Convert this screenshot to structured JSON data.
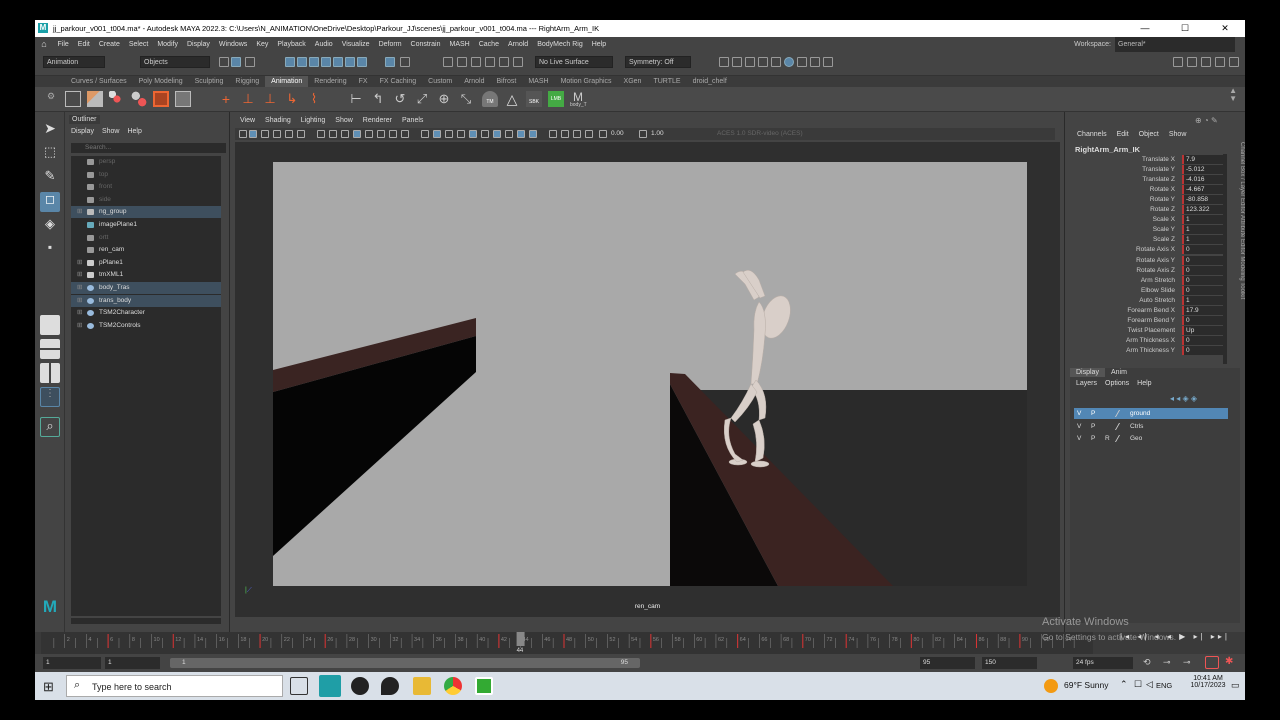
{
  "window": {
    "title": "jj_parkour_v001_t004.ma* - Autodesk MAYA 2022.3: C:\\Users\\N_ANIMATION\\OneDrive\\Desktop\\Parkour_JJ\\scenes\\jj_parkour_v001_t004.ma  ---  RightArm_Arm_IK",
    "min": "—",
    "max": "☐",
    "close": "✕"
  },
  "menubar": {
    "items": [
      "File",
      "Edit",
      "Create",
      "Select",
      "Modify",
      "Display",
      "Windows",
      "Key",
      "Playback",
      "Audio",
      "Visualize",
      "Deform",
      "Constrain",
      "MASH",
      "Cache",
      "Arnold",
      "BodyMech Rig",
      "Help"
    ],
    "workspace_label": "Workspace:",
    "workspace_value": "General*"
  },
  "statusline": {
    "mode": "Animation",
    "objects": "Objects",
    "live_surface": "No Live Surface",
    "symmetry": "Symmetry: Off"
  },
  "shelf": {
    "tabs": [
      "Curves / Surfaces",
      "Poly Modeling",
      "Sculpting",
      "Rigging",
      "Animation",
      "Rendering",
      "FX",
      "FX Caching",
      "Custom",
      "Arnold",
      "Bifrost",
      "MASH",
      "Motion Graphics",
      "XGen",
      "TURTLE",
      "droid_chelf"
    ],
    "active": "Animation",
    "icon_labels": [
      "TM",
      "SBK",
      "LMB",
      "body_T"
    ]
  },
  "outliner": {
    "tab": "Outliner",
    "menu": [
      "Display",
      "Show",
      "Help"
    ],
    "search_placeholder": "Search...",
    "items": [
      {
        "name": "persp",
        "dim": true,
        "exp": "",
        "icon": "camera"
      },
      {
        "name": "top",
        "dim": true,
        "exp": "",
        "icon": "camera"
      },
      {
        "name": "front",
        "dim": true,
        "exp": "",
        "icon": "camera"
      },
      {
        "name": "side",
        "dim": true,
        "exp": "",
        "icon": "camera"
      },
      {
        "name": "ng_group",
        "dim": false,
        "exp": "⊞",
        "icon": "group",
        "hl": true
      },
      {
        "name": "imagePlane1",
        "dim": false,
        "exp": "",
        "icon": "image"
      },
      {
        "name": "ortt",
        "dim": true,
        "exp": "",
        "icon": "camera"
      },
      {
        "name": "ren_cam",
        "dim": false,
        "exp": "",
        "icon": "camera"
      },
      {
        "name": "pPlane1",
        "dim": false,
        "exp": "⊞",
        "icon": "mesh"
      },
      {
        "name": "tmXML1",
        "dim": false,
        "exp": "⊞",
        "icon": "mesh"
      },
      {
        "name": "body_Tras",
        "dim": false,
        "exp": "⊞",
        "icon": "set",
        "hl": true
      },
      {
        "name": "trans_body",
        "dim": false,
        "exp": "⊞",
        "icon": "set",
        "hl": true
      },
      {
        "name": "TSM2Character",
        "dim": false,
        "exp": "⊞",
        "icon": "set"
      },
      {
        "name": "TSM2Controls",
        "dim": false,
        "exp": "⊞",
        "icon": "set"
      }
    ]
  },
  "viewport": {
    "menu": [
      "View",
      "Shading",
      "Lighting",
      "Show",
      "Renderer",
      "Panels"
    ],
    "exposure": "0.00",
    "gamma": "1.00",
    "colorspace": "ACES 1.0 SDR-video (ACES)",
    "camera": "ren_cam"
  },
  "channels": {
    "menu": [
      "Channels",
      "Edit",
      "Object",
      "Show"
    ],
    "object": "RightArm_Arm_IK",
    "attrs": [
      {
        "n": "Translate X",
        "v": "7.9"
      },
      {
        "n": "Translate Y",
        "v": "-5.012"
      },
      {
        "n": "Translate Z",
        "v": "-4.016"
      },
      {
        "n": "Rotate X",
        "v": "-4.667"
      },
      {
        "n": "Rotate Y",
        "v": "-80.858"
      },
      {
        "n": "Rotate Z",
        "v": "123.322"
      },
      {
        "n": "Scale X",
        "v": "1"
      },
      {
        "n": "Scale Y",
        "v": "1"
      },
      {
        "n": "Scale Z",
        "v": "1"
      },
      {
        "n": "Rotate Axis X",
        "v": "0"
      },
      {
        "n": "Rotate Axis Y",
        "v": "0"
      },
      {
        "n": "Rotate Axis Z",
        "v": "0"
      },
      {
        "n": "Arm Stretch",
        "v": "0"
      },
      {
        "n": "Elbow Slide",
        "v": "0"
      },
      {
        "n": "Auto Stretch",
        "v": "1"
      },
      {
        "n": "Forearm Bend X",
        "v": "17.9"
      },
      {
        "n": "Forearm Bend Y",
        "v": "0"
      },
      {
        "n": "Twist Placement",
        "v": "Up"
      },
      {
        "n": "Arm Thickness X",
        "v": "0"
      },
      {
        "n": "Arm Thickness Y",
        "v": "0"
      }
    ],
    "side_tabs": "Channel Box / Layer Editor   Attribute Editor   Modeling Toolkit"
  },
  "layers": {
    "tabs": [
      "Display",
      "Anim"
    ],
    "menu": [
      "Layers",
      "Options",
      "Help"
    ],
    "rows": [
      {
        "v": "V",
        "p": "P",
        "r": "",
        "name": "ground",
        "sel": true
      },
      {
        "v": "V",
        "p": "P",
        "r": "",
        "name": "Ctrls",
        "sel": false
      },
      {
        "v": "V",
        "p": "P",
        "r": "R",
        "name": "Geo",
        "sel": false
      }
    ]
  },
  "timeline": {
    "ticks": [
      "2",
      "4",
      "6",
      "8",
      "10",
      "12",
      "14",
      "16",
      "18",
      "20",
      "22",
      "24",
      "26",
      "28",
      "30",
      "32",
      "34",
      "36",
      "38",
      "40",
      "42",
      "44",
      "46",
      "48",
      "50",
      "52",
      "54",
      "56",
      "58",
      "60",
      "62",
      "64",
      "66",
      "68",
      "70",
      "72",
      "74",
      "76",
      "78",
      "80",
      "82",
      "84",
      "86",
      "88",
      "90",
      "92",
      "94"
    ],
    "current": "44",
    "current_frame": "44"
  },
  "range": {
    "start": "1",
    "playstart": "1",
    "slider_start": "1",
    "slider_end": "95",
    "playend": "95",
    "end": "150",
    "fps": "24 fps"
  },
  "taskbar": {
    "search": "Type here to search",
    "weather": "69°F  Sunny",
    "lang": "ENG",
    "time": "10:41 AM",
    "date": "10/17/2023"
  },
  "watermark": {
    "line1": "Activate Windows",
    "line2": "Go to Settings to activate Windows."
  }
}
